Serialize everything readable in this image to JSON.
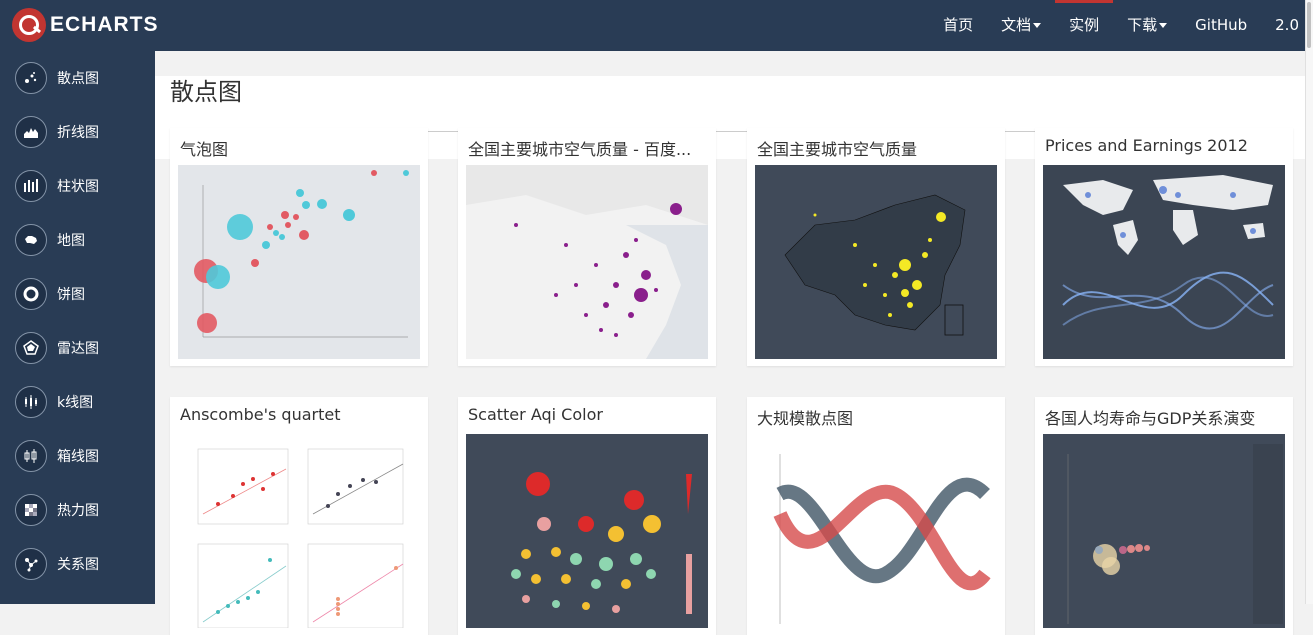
{
  "app": {
    "logo_text": "ECHARTS"
  },
  "nav": {
    "items": [
      {
        "label": "首页"
      },
      {
        "label": "文档"
      },
      {
        "label": "实例"
      },
      {
        "label": "下载"
      },
      {
        "label": "GitHub"
      },
      {
        "label": "2.0"
      }
    ]
  },
  "sidebar": {
    "items": [
      {
        "label": "散点图",
        "icon": "scatter-icon"
      },
      {
        "label": "折线图",
        "icon": "line-icon"
      },
      {
        "label": "柱状图",
        "icon": "bar-icon"
      },
      {
        "label": "地图",
        "icon": "map-icon"
      },
      {
        "label": "饼图",
        "icon": "pie-icon"
      },
      {
        "label": "雷达图",
        "icon": "radar-icon"
      },
      {
        "label": "k线图",
        "icon": "candlestick-icon"
      },
      {
        "label": "箱线图",
        "icon": "boxplot-icon"
      },
      {
        "label": "热力图",
        "icon": "heatmap-icon"
      },
      {
        "label": "关系图",
        "icon": "graph-icon"
      }
    ]
  },
  "main": {
    "title": "散点图",
    "cards": [
      {
        "title": "气泡图"
      },
      {
        "title": "全国主要城市空气质量 - 百度..."
      },
      {
        "title": "全国主要城市空气质量"
      },
      {
        "title": "Prices and Earnings 2012"
      },
      {
        "title": "Anscombe's quartet"
      },
      {
        "title": "Scatter Aqi Color"
      },
      {
        "title": "大规模散点图"
      },
      {
        "title": "各国人均寿命与GDP关系演变"
      }
    ]
  },
  "colors": {
    "nav_bg": "#293c55",
    "accent": "#c23531"
  }
}
